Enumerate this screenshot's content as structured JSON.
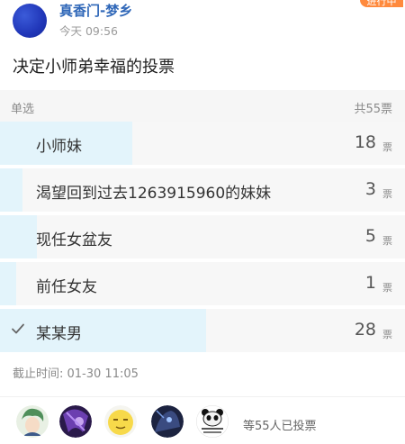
{
  "post": {
    "author": "真香门-梦乡",
    "time": "今天 09:56",
    "status": "进行中",
    "question": "决定小师弟幸福的投票"
  },
  "poll": {
    "type": "单选",
    "total": "共55票",
    "unit": "票",
    "options": [
      {
        "label": "小师妹",
        "count": "18",
        "fraction": 0.327,
        "checked": false
      },
      {
        "label": "渴望回到过去1263915960的妹妹",
        "count": "3",
        "fraction": 0.055,
        "checked": false
      },
      {
        "label": "现任女盆友",
        "count": "5",
        "fraction": 0.091,
        "checked": false
      },
      {
        "label": "前任女友",
        "count": "1",
        "fraction": 0.018,
        "checked": false
      },
      {
        "label": "某某男",
        "count": "28",
        "fraction": 0.509,
        "checked": true
      }
    ],
    "deadline": "截止时间: 01-30 11:05"
  },
  "voters": {
    "summary": "等55人已投票",
    "avatars": [
      "green-hair-avatar",
      "purple-anime-avatar",
      "emoji-face-avatar",
      "dark-anime-avatar",
      "panda-meme-avatar"
    ]
  },
  "colors": {
    "accent_blue": "#2f67b8",
    "fill": "#e3f4fb",
    "option_bg": "#f7f7f7",
    "badge": "#ff8a3d"
  }
}
